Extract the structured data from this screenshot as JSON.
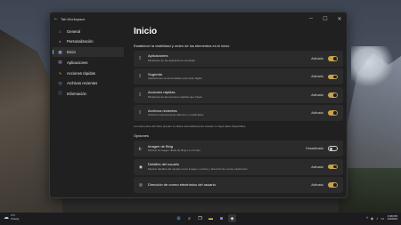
{
  "window": {
    "title": "Tab Workspace",
    "minimize": "─",
    "maximize": "☐",
    "close": "✕"
  },
  "sidebar": {
    "items": [
      {
        "label": "General",
        "icon": "home-icon",
        "glyph": "⌂",
        "active": false
      },
      {
        "label": "Personalización",
        "icon": "palette-icon",
        "glyph": "◐",
        "active": false
      },
      {
        "label": "Inicio",
        "icon": "start-icon",
        "glyph": "▦",
        "active": true
      },
      {
        "label": "Aplicaciones",
        "icon": "apps-icon",
        "glyph": "▤",
        "active": false
      },
      {
        "label": "Acciones rápidas",
        "icon": "lightning-icon",
        "glyph": "ϟ",
        "active": false
      },
      {
        "label": "Archivos recientes",
        "icon": "clock-icon",
        "glyph": "◷",
        "active": false
      },
      {
        "label": "Información",
        "icon": "info-icon",
        "glyph": "ⓘ",
        "active": false
      }
    ]
  },
  "main": {
    "title": "Inicio",
    "section_heading": "Establecer la visibilidad y orden de los elementos en el inicio",
    "cards": [
      {
        "title": "Aplicaciones",
        "subtitle": "Miniaturas de las aplicaciones ancladas",
        "state": "Activado"
      },
      {
        "title": "Sugerido",
        "subtitle": "Aplicaciones recomendadas para Apps digital",
        "state": "Activado"
      },
      {
        "title": "Acciones rápidas",
        "subtitle": "Miniaturas de las acciones rápidas que Xpeta",
        "state": "Activado"
      },
      {
        "title": "Archivos recientes",
        "subtitle": "Archivos recientemente abiertos o modificados",
        "state": "Activado"
      }
    ],
    "note": "Los elementos del inicio pueden su altura automáticamente cuando no haya datos disponibles",
    "options_heading": "Opciones",
    "options": [
      {
        "title": "Imagen de Bing",
        "subtitle": "Mostrar la imagen diaria de Bing en el fondo",
        "state": "Desactivado",
        "icon": "bing-icon",
        "glyph": "ᵬ"
      },
      {
        "title": "Detalles del usuario",
        "subtitle": "Mostrar detalles del usuario como imagen, nombre y dirección de correo electrónico",
        "state": "Activado",
        "icon": "user-icon",
        "glyph": "◉"
      },
      {
        "title": "Dirección de correo electrónico del usuario",
        "subtitle": "",
        "state": "Activado",
        "icon": "mail-icon",
        "glyph": "◎"
      }
    ]
  },
  "taskbar": {
    "weather_temp": "3°C",
    "weather_desc": "Cloudy",
    "clock_time": "3:38 PM",
    "clock_date": "1/3/2023"
  },
  "colors": {
    "accent_toggle": "#c9a24e",
    "active_indicator": "#76b9ed",
    "window_bg": "#202020",
    "card_bg": "#2b2b2b"
  }
}
